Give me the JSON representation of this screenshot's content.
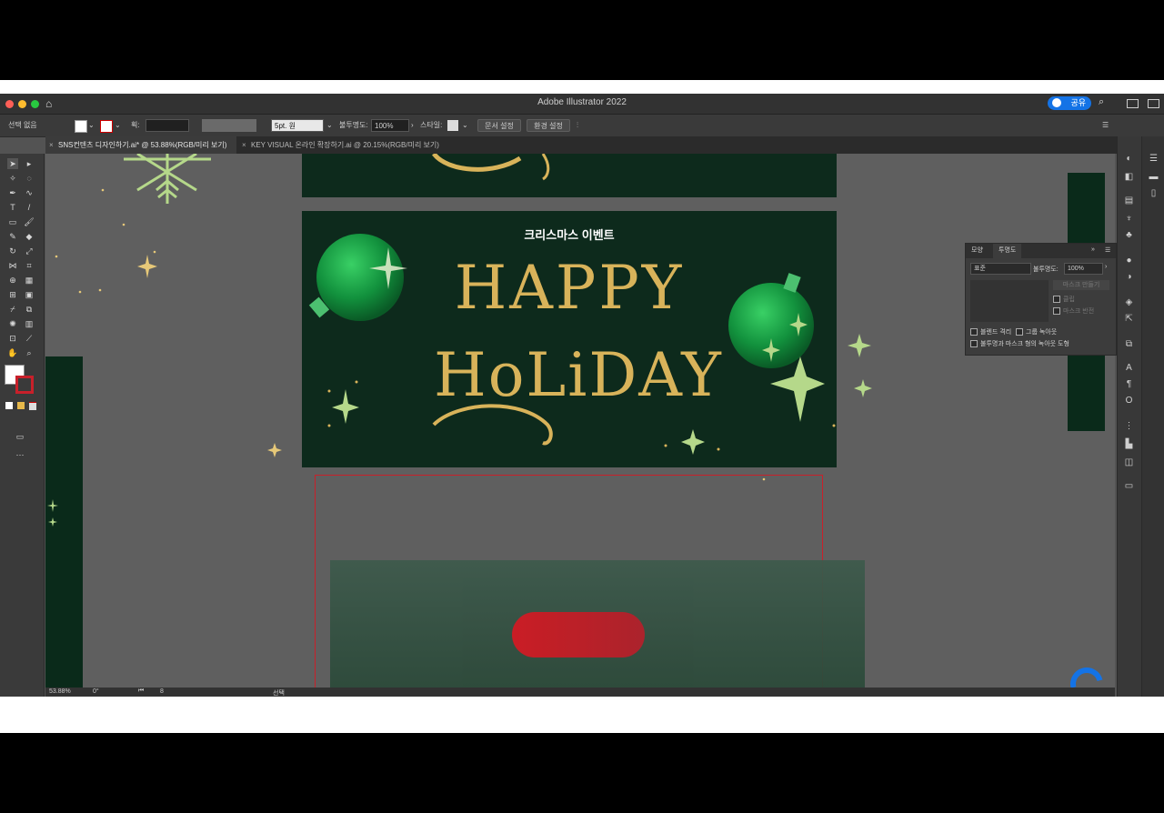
{
  "window": {
    "title": "Adobe Illustrator 2022",
    "share_label": "공유"
  },
  "controlbar": {
    "selection": "선택 없음",
    "stroke_label": "획:",
    "stroke_weight": "5pt. 원",
    "opacity_label": "불투명도:",
    "opacity_value": "100%",
    "style_label": "스타일:",
    "doc_setup_button": "문서 설정",
    "preferences_button": "환경 설정"
  },
  "tabs": [
    {
      "label": "SNS컨텐츠 디자인하기.ai* @ 53.88%(RGB/미리 보기)",
      "active": true
    },
    {
      "label": "KEY VISUAL 온라인 확장하기.ai @ 20.15%(RGB/미리 보기)",
      "active": false
    }
  ],
  "artboard": {
    "subtitle": "크리스마스 이벤트",
    "headline_line1": "HAPPY",
    "headline_line2": "HoLiDAY"
  },
  "panel": {
    "tabs": [
      "모양",
      "투명도"
    ],
    "blend_mode": "표준",
    "opacity_label": "불투명도:",
    "opacity_value": "100%",
    "make_mask_button": "마스크 만들기",
    "clip_label": "클립",
    "invert_mask_label": "마스크 반전",
    "isolate_blending": "블렌드 격리",
    "knockout_group": "그룹 녹아웃",
    "opacity_mask_knockout": "불투명과 마스크 형의 녹아웃 도형"
  },
  "statusbar": {
    "zoom": "53.88%",
    "rotation": "0°",
    "artboard_number": "8",
    "tool_name": "선택"
  },
  "colors": {
    "accent": "#1473e6",
    "artboard_bg": "#0d2a1c",
    "gold": "#d8b35a",
    "ornament_green": "#1aa04a",
    "star_green": "#b5d88a",
    "button_red": "#c8202a",
    "selection_red": "#c8202a"
  }
}
